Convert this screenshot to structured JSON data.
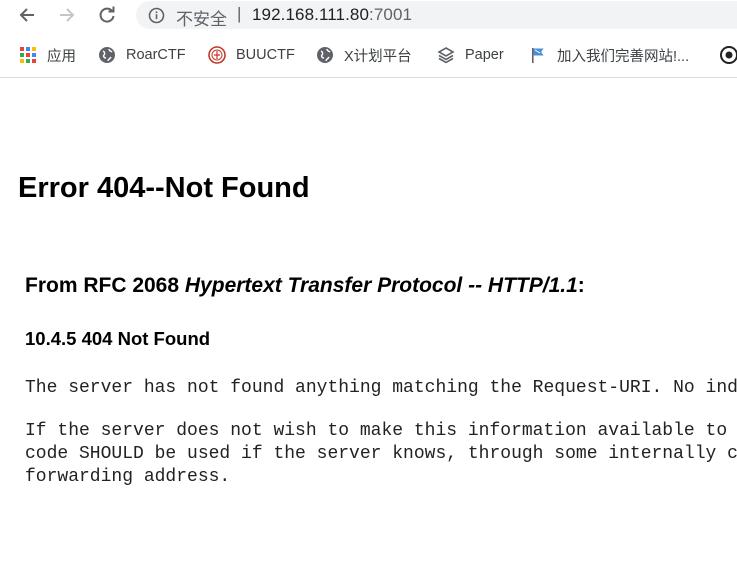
{
  "browser": {
    "omnibox": {
      "security_label": "不安全",
      "separator": "|",
      "host": "192.168.111.80",
      "port": ":7001"
    },
    "bookmarks": [
      {
        "label": "应用",
        "icon": "apps-grid-icon"
      },
      {
        "label": "RoarCTF",
        "icon": "globe-icon"
      },
      {
        "label": "BUUCTF",
        "icon": "buuctf-seal-icon"
      },
      {
        "label": "X计划平台",
        "icon": "globe-icon"
      },
      {
        "label": "Paper",
        "icon": "layers-icon"
      },
      {
        "label": "加入我们完善网站!...",
        "icon": "flag-icon"
      }
    ]
  },
  "page": {
    "title": "Error 404--Not Found",
    "rfc_heading_prefix": "From RFC 2068 ",
    "rfc_heading_title": "Hypertext Transfer Protocol -- HTTP/1.1",
    "rfc_heading_suffix": ":",
    "section_heading": "10.4.5 404 Not Found",
    "paragraph1": "The server has not found anything matching the Request-URI. No indication is given of whether the condition is temporary or permanent.",
    "paragraph2_line1": "If the server does not wish to make this information available to the client, the status code 403 (Forbidden) can be used instead. The 410 (Gone) status",
    "paragraph2_line2": "code SHOULD be used if the server knows, through some internally configurable mechanism, that an old resource is permanently unavailable and has no",
    "paragraph2_line3": "forwarding address."
  }
}
